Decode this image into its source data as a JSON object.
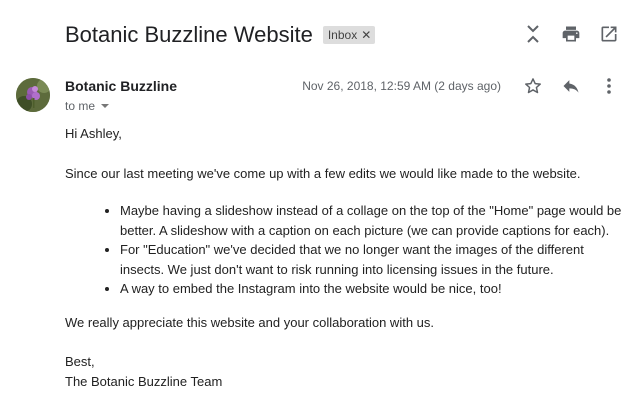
{
  "email": {
    "subject": "Botanic Buzzline Website",
    "label": "Inbox",
    "sender_name": "Botanic Buzzline",
    "recipient": "to me",
    "date": "Nov 26, 2018, 12:59 AM (2 days ago)"
  },
  "body": {
    "greeting": "Hi Ashley,",
    "intro": "Since our last meeting we've come up with a few edits we would like made to the website.",
    "bullets": [
      "Maybe having a slideshow instead of a collage on the top of the \"Home\" page would be better. A slideshow with a caption on each picture (we can provide captions for each).",
      "For \"Education\" we've decided that we no longer want the images of the different insects. We just don't want to risk running into licensing issues in the future.",
      "A way to embed the Instagram into the website would be nice, too!"
    ],
    "closing": "We really appreciate this website and your collaboration with us.",
    "signoff": "Best,",
    "signature": "The Botanic Buzzline Team"
  },
  "icons": {
    "label_remove": "close-icon",
    "collapse": "collapse-icon",
    "print": "print-icon",
    "new_window": "open-in-new-icon",
    "star": "star-icon",
    "reply": "reply-icon",
    "more": "more-vert-icon"
  }
}
